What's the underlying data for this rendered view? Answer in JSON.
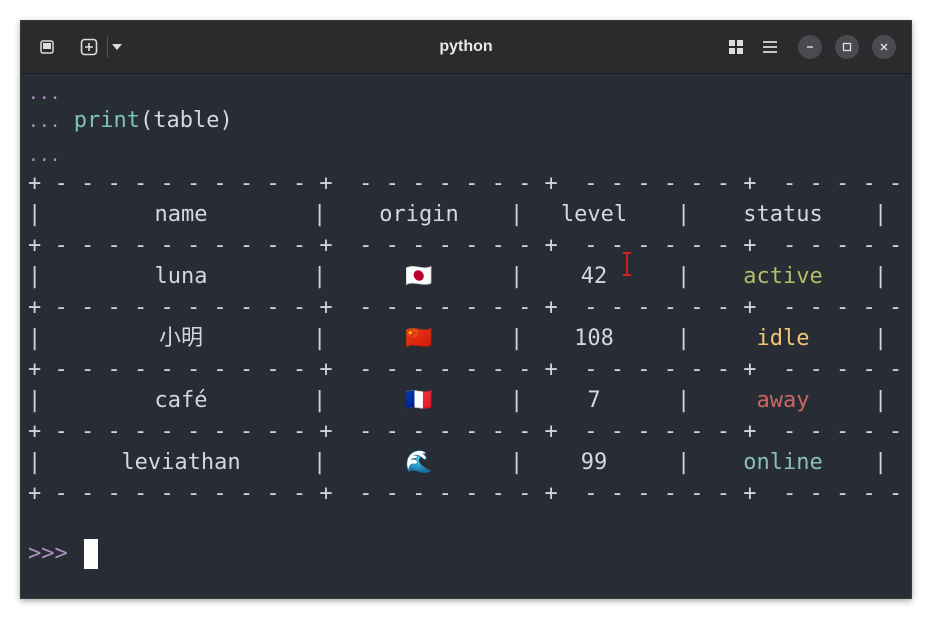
{
  "window": {
    "title": "python",
    "new_tab_icon": "new-tab-icon",
    "menu_icon": "hamburger-menu-icon",
    "grid_icon": "tab-overview-icon",
    "minimize_icon": "minimize-icon",
    "maximize_icon": "maximize-icon",
    "close_icon": "close-icon"
  },
  "terminal": {
    "continuation_prompt": "...",
    "command_fn": "print",
    "command_args": "(table)",
    "table": {
      "headers": [
        "name",
        "origin",
        "level",
        "status"
      ],
      "rows": [
        {
          "name": "luna",
          "origin": "🇯🇵",
          "level": "42",
          "status": "active",
          "status_color": "#b5bd68"
        },
        {
          "name": "小明",
          "origin": "🇨🇳",
          "level": "108",
          "status": "idle",
          "status_color": "#f0c674"
        },
        {
          "name": "café",
          "origin": "🇫🇷",
          "level": "7",
          "status": "away",
          "status_color": "#cc6666"
        },
        {
          "name": "leviathan",
          "origin": "🌊",
          "level": "99",
          "status": "online",
          "status_color": "#8abeb7"
        }
      ]
    },
    "prompt": ">>>"
  },
  "colors": {
    "background": "#282c34",
    "prompt": "#b08fc4",
    "function": "#7ec4b6"
  }
}
